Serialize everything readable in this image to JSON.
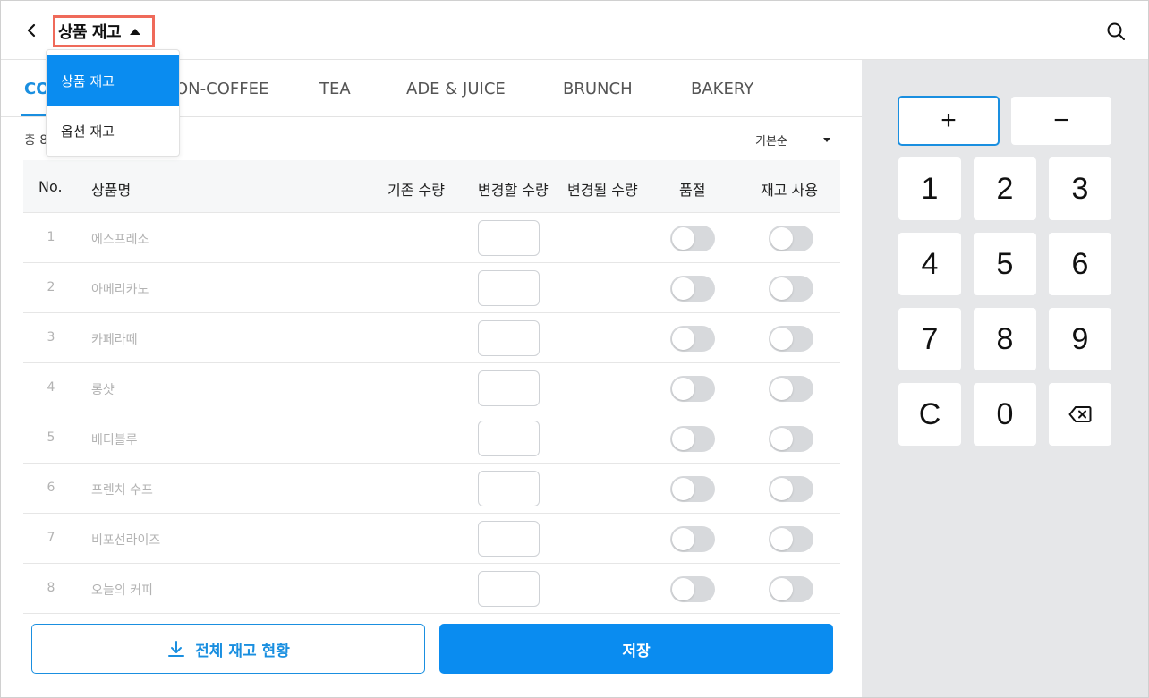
{
  "header": {
    "title": "상품 재고",
    "back_icon": "chevron-left-icon",
    "search_icon": "search-icon"
  },
  "dropdown": {
    "items": [
      "상품 재고",
      "옵션 재고"
    ],
    "selected": "상품 재고"
  },
  "tabs": [
    {
      "label": "CO",
      "active": true
    },
    {
      "label": "ON-COFFEE",
      "active": false
    },
    {
      "label": "TEA",
      "active": false
    },
    {
      "label": "ADE & JUICE",
      "active": false
    },
    {
      "label": "BRUNCH",
      "active": false
    },
    {
      "label": "BAKERY",
      "active": false
    }
  ],
  "list": {
    "count_text": "총 8",
    "sort_label": "기본순"
  },
  "table": {
    "headers": {
      "no": "No.",
      "name": "상품명",
      "current_qty": "기존 수량",
      "change_qty": "변경할 수량",
      "new_qty": "변경될 수량",
      "soldout": "품절",
      "stock_use": "재고 사용"
    },
    "rows": [
      {
        "no": "1",
        "name": "에스프레소",
        "soldout": false,
        "stock_use": false
      },
      {
        "no": "2",
        "name": "아메리카노",
        "soldout": false,
        "stock_use": false
      },
      {
        "no": "3",
        "name": "카페라떼",
        "soldout": false,
        "stock_use": false
      },
      {
        "no": "4",
        "name": "롱샷",
        "soldout": false,
        "stock_use": false
      },
      {
        "no": "5",
        "name": "베티블루",
        "soldout": false,
        "stock_use": false
      },
      {
        "no": "6",
        "name": "프렌치 수프",
        "soldout": false,
        "stock_use": false
      },
      {
        "no": "7",
        "name": "비포선라이즈",
        "soldout": false,
        "stock_use": false
      },
      {
        "no": "8",
        "name": "오늘의 커피",
        "soldout": false,
        "stock_use": false
      }
    ]
  },
  "buttons": {
    "export_label": "전체 재고 현황",
    "export_icon": "download-icon",
    "save_label": "저장"
  },
  "keypad": {
    "plus": "+",
    "minus": "−",
    "keys": [
      "1",
      "2",
      "3",
      "4",
      "5",
      "6",
      "7",
      "8",
      "9",
      "C",
      "0"
    ],
    "backspace_icon": "backspace-icon"
  },
  "colors": {
    "accent": "#0a8cf0",
    "highlight_border": "#ef6a5a",
    "panel_bg": "#e6e7e9",
    "toggle_off": "#d7d9dc"
  }
}
